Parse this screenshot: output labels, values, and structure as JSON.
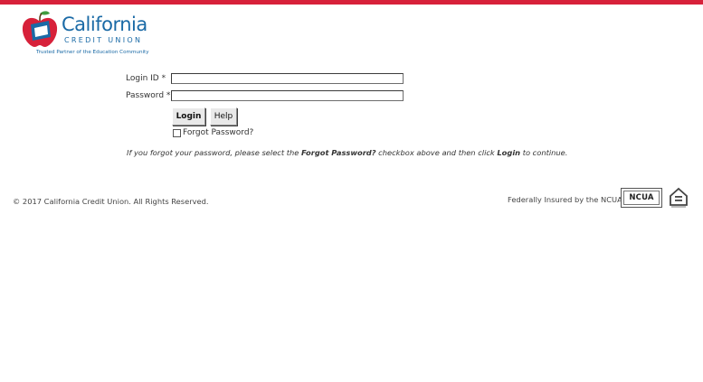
{
  "colors": {
    "accent_red": "#d7213a",
    "brand_blue": "#1a6aa6",
    "apple_red": "#d7213a",
    "leaf_green": "#3f9b3f"
  },
  "logo": {
    "name": "California",
    "subtitle": "CREDIT UNION",
    "tagline": "Trusted Partner of the Education Community",
    "icon": "apple-logo-icon"
  },
  "login_form": {
    "login_id_label": "Login ID *",
    "login_id_value": "",
    "password_label": "Password *",
    "password_value": "",
    "login_button": "Login",
    "help_button": "Help",
    "forgot_checkbox_label": "Forgot Password?",
    "forgot_checkbox_checked": false
  },
  "note": {
    "part1": "If you forgot your password, please select the ",
    "bold1": "Forgot Password?",
    "part2": " checkbox above and then click ",
    "bold2": "Login",
    "part3": " to continue."
  },
  "footer": {
    "copyright": "© 2017 California Credit Union. All Rights Reserved.",
    "insured": "Federally Insured by the NCUA",
    "ncua_badge": "NCUA",
    "ncua_icon": "ncua-badge-icon",
    "housing_icon": "equal-housing-lender-icon"
  }
}
